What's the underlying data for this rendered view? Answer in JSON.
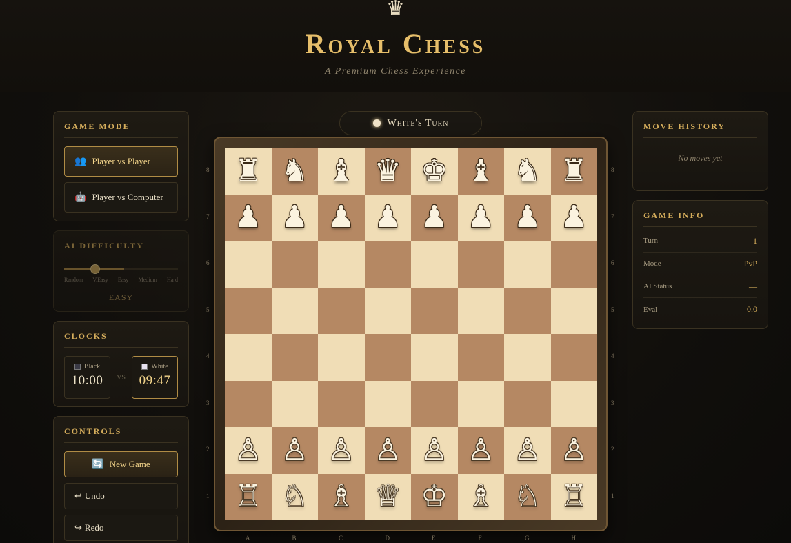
{
  "header": {
    "crown": "♛",
    "title": "Royal Chess",
    "subtitle": "A Premium Chess Experience"
  },
  "game_mode": {
    "title": "GAME MODE",
    "options": [
      {
        "label": "Player vs Player",
        "icon": "👥",
        "active": true
      },
      {
        "label": "Player vs Computer",
        "icon": "🤖",
        "active": false
      }
    ]
  },
  "ai_difficulty": {
    "title": "AI DIFFICULTY",
    "levels": [
      "Random",
      "V.Easy",
      "Easy",
      "Medium",
      "Hard"
    ],
    "selected_index": 2,
    "value": "EASY"
  },
  "clocks": {
    "title": "CLOCKS",
    "black": {
      "label": "Black",
      "time": "10:00"
    },
    "vs": "VS",
    "white": {
      "label": "White",
      "time": "09:47"
    }
  },
  "controls": {
    "title": "CONTROLS",
    "new_game": "New Game",
    "new_game_icon": "🔄",
    "undo": "Undo",
    "undo_icon": "↩",
    "redo": "Redo",
    "redo_icon": "↪"
  },
  "turn": {
    "text": "White's Turn"
  },
  "board": {
    "files": [
      "A",
      "B",
      "C",
      "D",
      "E",
      "F",
      "G",
      "H"
    ],
    "ranks": [
      "8",
      "7",
      "6",
      "5",
      "4",
      "3",
      "2",
      "1"
    ],
    "position": [
      [
        "r",
        "n",
        "b",
        "q",
        "k",
        "b",
        "n",
        "r"
      ],
      [
        "p",
        "p",
        "p",
        "p",
        "p",
        "p",
        "p",
        "p"
      ],
      [
        "",
        "",
        "",
        "",
        "",
        "",
        "",
        ""
      ],
      [
        "",
        "",
        "",
        "",
        "",
        "",
        "",
        ""
      ],
      [
        "",
        "",
        "",
        "",
        "",
        "",
        "",
        ""
      ],
      [
        "",
        "",
        "",
        "",
        "",
        "",
        "",
        ""
      ],
      [
        "P",
        "P",
        "P",
        "P",
        "P",
        "P",
        "P",
        "P"
      ],
      [
        "R",
        "N",
        "B",
        "Q",
        "K",
        "B",
        "N",
        "R"
      ]
    ]
  },
  "move_history": {
    "title": "MOVE HISTORY",
    "empty_text": "No moves yet"
  },
  "game_info": {
    "title": "GAME INFO",
    "rows": [
      {
        "label": "Turn",
        "value": "1"
      },
      {
        "label": "Mode",
        "value": "PvP"
      },
      {
        "label": "AI Status",
        "value": "—"
      },
      {
        "label": "Eval",
        "value": "0.0"
      }
    ]
  }
}
